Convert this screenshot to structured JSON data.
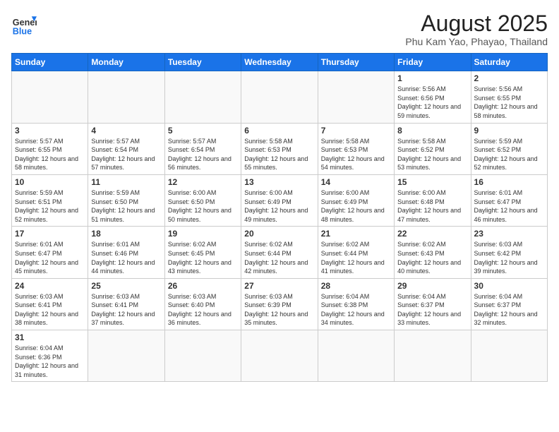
{
  "header": {
    "logo_general": "General",
    "logo_blue": "Blue",
    "month_year": "August 2025",
    "location": "Phu Kam Yao, Phayao, Thailand"
  },
  "weekdays": [
    "Sunday",
    "Monday",
    "Tuesday",
    "Wednesday",
    "Thursday",
    "Friday",
    "Saturday"
  ],
  "weeks": [
    [
      {
        "day": null
      },
      {
        "day": null
      },
      {
        "day": null
      },
      {
        "day": null
      },
      {
        "day": null
      },
      {
        "day": "1",
        "sunrise": "5:56 AM",
        "sunset": "6:56 PM",
        "daylight": "12 hours and 59 minutes."
      },
      {
        "day": "2",
        "sunrise": "5:56 AM",
        "sunset": "6:55 PM",
        "daylight": "12 hours and 58 minutes."
      }
    ],
    [
      {
        "day": "3",
        "sunrise": "5:57 AM",
        "sunset": "6:55 PM",
        "daylight": "12 hours and 58 minutes."
      },
      {
        "day": "4",
        "sunrise": "5:57 AM",
        "sunset": "6:54 PM",
        "daylight": "12 hours and 57 minutes."
      },
      {
        "day": "5",
        "sunrise": "5:57 AM",
        "sunset": "6:54 PM",
        "daylight": "12 hours and 56 minutes."
      },
      {
        "day": "6",
        "sunrise": "5:58 AM",
        "sunset": "6:53 PM",
        "daylight": "12 hours and 55 minutes."
      },
      {
        "day": "7",
        "sunrise": "5:58 AM",
        "sunset": "6:53 PM",
        "daylight": "12 hours and 54 minutes."
      },
      {
        "day": "8",
        "sunrise": "5:58 AM",
        "sunset": "6:52 PM",
        "daylight": "12 hours and 53 minutes."
      },
      {
        "day": "9",
        "sunrise": "5:59 AM",
        "sunset": "6:52 PM",
        "daylight": "12 hours and 52 minutes."
      }
    ],
    [
      {
        "day": "10",
        "sunrise": "5:59 AM",
        "sunset": "6:51 PM",
        "daylight": "12 hours and 52 minutes."
      },
      {
        "day": "11",
        "sunrise": "5:59 AM",
        "sunset": "6:50 PM",
        "daylight": "12 hours and 51 minutes."
      },
      {
        "day": "12",
        "sunrise": "6:00 AM",
        "sunset": "6:50 PM",
        "daylight": "12 hours and 50 minutes."
      },
      {
        "day": "13",
        "sunrise": "6:00 AM",
        "sunset": "6:49 PM",
        "daylight": "12 hours and 49 minutes."
      },
      {
        "day": "14",
        "sunrise": "6:00 AM",
        "sunset": "6:49 PM",
        "daylight": "12 hours and 48 minutes."
      },
      {
        "day": "15",
        "sunrise": "6:00 AM",
        "sunset": "6:48 PM",
        "daylight": "12 hours and 47 minutes."
      },
      {
        "day": "16",
        "sunrise": "6:01 AM",
        "sunset": "6:47 PM",
        "daylight": "12 hours and 46 minutes."
      }
    ],
    [
      {
        "day": "17",
        "sunrise": "6:01 AM",
        "sunset": "6:47 PM",
        "daylight": "12 hours and 45 minutes."
      },
      {
        "day": "18",
        "sunrise": "6:01 AM",
        "sunset": "6:46 PM",
        "daylight": "12 hours and 44 minutes."
      },
      {
        "day": "19",
        "sunrise": "6:02 AM",
        "sunset": "6:45 PM",
        "daylight": "12 hours and 43 minutes."
      },
      {
        "day": "20",
        "sunrise": "6:02 AM",
        "sunset": "6:44 PM",
        "daylight": "12 hours and 42 minutes."
      },
      {
        "day": "21",
        "sunrise": "6:02 AM",
        "sunset": "6:44 PM",
        "daylight": "12 hours and 41 minutes."
      },
      {
        "day": "22",
        "sunrise": "6:02 AM",
        "sunset": "6:43 PM",
        "daylight": "12 hours and 40 minutes."
      },
      {
        "day": "23",
        "sunrise": "6:03 AM",
        "sunset": "6:42 PM",
        "daylight": "12 hours and 39 minutes."
      }
    ],
    [
      {
        "day": "24",
        "sunrise": "6:03 AM",
        "sunset": "6:41 PM",
        "daylight": "12 hours and 38 minutes."
      },
      {
        "day": "25",
        "sunrise": "6:03 AM",
        "sunset": "6:41 PM",
        "daylight": "12 hours and 37 minutes."
      },
      {
        "day": "26",
        "sunrise": "6:03 AM",
        "sunset": "6:40 PM",
        "daylight": "12 hours and 36 minutes."
      },
      {
        "day": "27",
        "sunrise": "6:03 AM",
        "sunset": "6:39 PM",
        "daylight": "12 hours and 35 minutes."
      },
      {
        "day": "28",
        "sunrise": "6:04 AM",
        "sunset": "6:38 PM",
        "daylight": "12 hours and 34 minutes."
      },
      {
        "day": "29",
        "sunrise": "6:04 AM",
        "sunset": "6:37 PM",
        "daylight": "12 hours and 33 minutes."
      },
      {
        "day": "30",
        "sunrise": "6:04 AM",
        "sunset": "6:37 PM",
        "daylight": "12 hours and 32 minutes."
      }
    ],
    [
      {
        "day": "31",
        "sunrise": "6:04 AM",
        "sunset": "6:36 PM",
        "daylight": "12 hours and 31 minutes."
      },
      {
        "day": null
      },
      {
        "day": null
      },
      {
        "day": null
      },
      {
        "day": null
      },
      {
        "day": null
      },
      {
        "day": null
      }
    ]
  ]
}
